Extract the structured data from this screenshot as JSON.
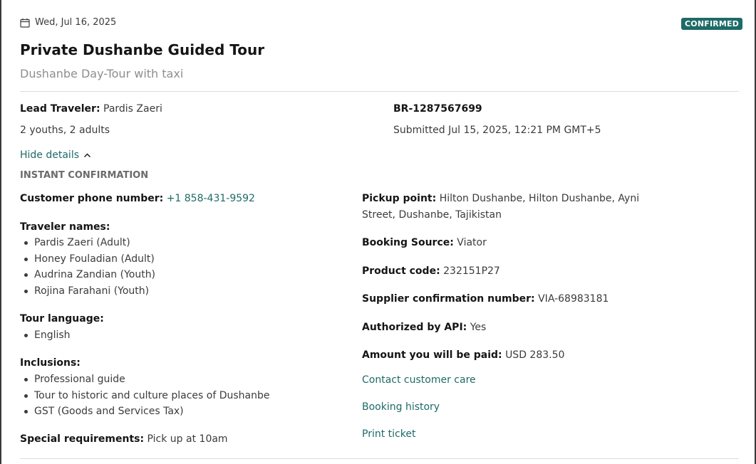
{
  "booking": {
    "date": "Wed, Jul 16, 2025",
    "status": "CONFIRMED",
    "title": "Private Dushanbe Guided Tour",
    "subtitle": "Dushanbe Day-Tour with taxi",
    "lead_traveler_label": "Lead Traveler:",
    "lead_traveler": "Pardis Zaeri",
    "party": "2 youths, 2 adults",
    "reference": "BR-1287567699",
    "submitted": "Submitted Jul 15, 2025, 12:21 PM GMT+5",
    "hide_details": "Hide details",
    "confirmation_type": "INSTANT CONFIRMATION"
  },
  "details": {
    "phone_label": "Customer phone number:",
    "phone": "+1 858-431-9592",
    "traveler_names_label": "Traveler names:",
    "traveler_names": [
      "Pardis Zaeri (Adult)",
      "Honey Fouladian (Adult)",
      "Audrina Zandian (Youth)",
      "Rojina Farahani (Youth)"
    ],
    "language_label": "Tour language:",
    "languages": [
      "English"
    ],
    "inclusions_label": "Inclusions:",
    "inclusions": [
      "Professional guide",
      "Tour to historic and culture places of Dushanbe",
      "GST (Goods and Services Tax)"
    ],
    "special_label": "Special requirements:",
    "special": "Pick up at 10am",
    "pickup_label": "Pickup point:",
    "pickup": "Hilton Dushanbe, Hilton Dushanbe, Ayni Street, Dushanbe, Tajikistan",
    "source_label": "Booking Source:",
    "source": "Viator",
    "product_label": "Product code:",
    "product": "232151P27",
    "supplier_label": "Supplier confirmation number:",
    "supplier": "VIA-68983181",
    "api_label": "Authorized by API:",
    "api": "Yes",
    "amount_label": "Amount you will be paid:",
    "amount": "USD 283.50"
  },
  "links": {
    "contact": "Contact customer care",
    "history": "Booking history",
    "print": "Print ticket"
  },
  "icons": {
    "date": "calendar-icon",
    "toggle": "chevron-up-icon"
  },
  "colors": {
    "accent": "#1d6b67",
    "badge_bg": "#1d6b67",
    "muted": "#8e8e8e"
  }
}
